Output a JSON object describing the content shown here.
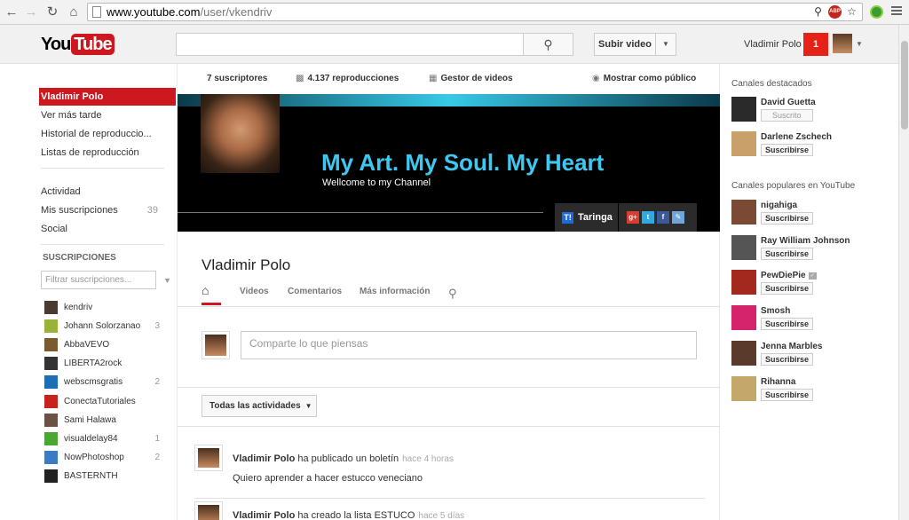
{
  "browser": {
    "url_host": "www.youtube.com",
    "url_path": "/user/vkendriv"
  },
  "header": {
    "logo_you": "You",
    "logo_tube": "Tube",
    "search_placeholder": "",
    "upload_label": "Subir video",
    "user_name": "Vladimir Polo",
    "notification_count": "1"
  },
  "guide": {
    "items": [
      {
        "label": "Vladimir Polo",
        "active": true
      },
      {
        "label": "Ver más tarde"
      },
      {
        "label": "Historial de reproduccio..."
      },
      {
        "label": "Listas de reproducción"
      }
    ],
    "items2": [
      {
        "label": "Actividad",
        "count": ""
      },
      {
        "label": "Mis suscripciones",
        "count": "39"
      },
      {
        "label": "Social",
        "count": ""
      }
    ],
    "subs_heading": "SUSCRIPCIONES",
    "subs_filter_placeholder": "Filtrar suscripciones...",
    "subscriptions": [
      {
        "name": "kendriv",
        "count": "",
        "color": "#4a3a30"
      },
      {
        "name": "Johann Solorzanao",
        "count": "3",
        "color": "#9bb23a"
      },
      {
        "name": "AbbaVEVO",
        "count": "",
        "color": "#7a5a2e"
      },
      {
        "name": "LIBERTA2rock",
        "count": "",
        "color": "#333333"
      },
      {
        "name": "webscmsgratis",
        "count": "2",
        "color": "#1d6fb5"
      },
      {
        "name": "ConectaTutoriales",
        "count": "",
        "color": "#c8221c"
      },
      {
        "name": "Sami Halawa",
        "count": "",
        "color": "#6b5244"
      },
      {
        "name": "visualdelay84",
        "count": "1",
        "color": "#4aa832"
      },
      {
        "name": "NowPhotoshop",
        "count": "2",
        "color": "#3c7bc2"
      },
      {
        "name": "BASTERNTH",
        "count": "",
        "color": "#222222"
      }
    ]
  },
  "stats": {
    "subscribers": "7 suscriptores",
    "views": "4.137 reproducciones",
    "video_manager": "Gestor de videos",
    "view_as_public": "Mostrar como público"
  },
  "banner": {
    "title": "My Art.  My Soul.  My Heart",
    "subtitle": "Wellcome to my Channel",
    "taringa": "Taringa"
  },
  "channel": {
    "name": "Vladimir Polo",
    "tabs": [
      "Videos",
      "Comentarios",
      "Más información"
    ],
    "share_placeholder": "Comparte lo que piensas",
    "activity_filter": "Todas las actividades"
  },
  "feed": [
    {
      "author": "Vladimir Polo",
      "action": "ha publicado un boletín",
      "time": "hace 4 horas",
      "body": "Quiero aprender a hacer estucco veneciano"
    },
    {
      "author": "Vladimir Polo",
      "action": "ha creado la lista ESTUCO",
      "time": "hace 5 días",
      "body": ""
    }
  ],
  "right": {
    "featured_heading": "Canales destacados",
    "featured": [
      {
        "name": "David Guetta",
        "button": "Suscrito",
        "subscribed": true,
        "color": "#2a2a2a"
      },
      {
        "name": "Darlene Zschech",
        "button": "Suscribirse",
        "subscribed": false,
        "color": "#c9a06a"
      }
    ],
    "popular_heading": "Canales populares en YouTube",
    "popular": [
      {
        "name": "nigahiga",
        "button": "Suscribirse",
        "color": "#7a4a34",
        "verified": false
      },
      {
        "name": "Ray William Johnson",
        "button": "Suscribirse",
        "color": "#555555",
        "verified": false
      },
      {
        "name": "PewDiePie",
        "button": "Suscribirse",
        "color": "#a3291f",
        "verified": true
      },
      {
        "name": "Smosh",
        "button": "Suscribirse",
        "color": "#d6246c",
        "verified": false
      },
      {
        "name": "Jenna Marbles",
        "button": "Suscribirse",
        "color": "#5a3a2a",
        "verified": false
      },
      {
        "name": "Rihanna",
        "button": "Suscribirse",
        "color": "#c4a76b",
        "verified": false
      }
    ]
  }
}
